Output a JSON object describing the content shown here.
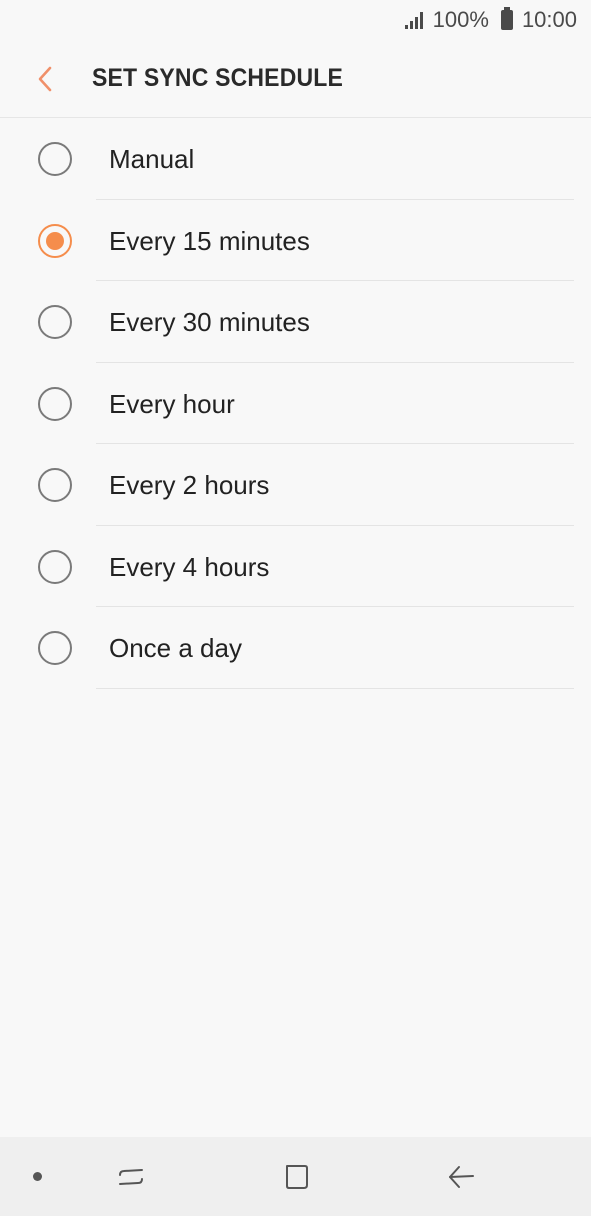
{
  "status_bar": {
    "battery_text": "100%",
    "time": "10:00"
  },
  "header": {
    "title": "SET SYNC SCHEDULE",
    "back_icon": "chevron-left-icon"
  },
  "options": [
    {
      "label": "Manual",
      "selected": false
    },
    {
      "label": "Every 15 minutes",
      "selected": true
    },
    {
      "label": "Every 30 minutes",
      "selected": false
    },
    {
      "label": "Every hour",
      "selected": false
    },
    {
      "label": "Every 2 hours",
      "selected": false
    },
    {
      "label": "Every 4 hours",
      "selected": false
    },
    {
      "label": "Once a day",
      "selected": false
    }
  ],
  "nav_bar": {
    "icons": [
      "dot-icon",
      "recents-icon",
      "home-icon",
      "back-arrow-icon"
    ]
  },
  "colors": {
    "accent": "#f58d4c",
    "background": "#f8f8f8",
    "nav_background": "#efefef"
  }
}
